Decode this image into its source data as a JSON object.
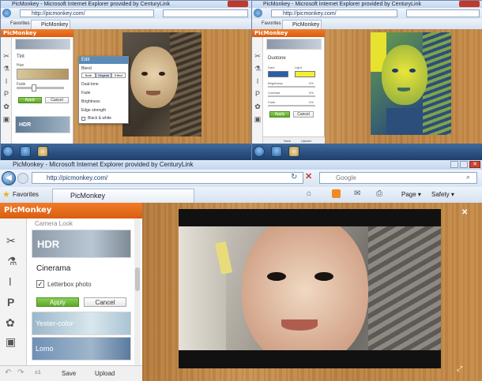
{
  "top_left_window": {
    "title": "PicMonkey - Microsoft Internet Explorer provided by CenturyLink",
    "url": "http://picmonkey.com/",
    "favorites_label": "Favorites",
    "tab_label": "PicMonkey",
    "brand": "PicMonkey",
    "panel": {
      "section_title": "Tint",
      "field1_label": "Hue",
      "field2_label": "Fade",
      "apply_label": "Apply",
      "cancel_label": "Cancel",
      "thumb_label": "HDR"
    },
    "popover": {
      "title": "Edit",
      "mode_label": "Blend",
      "mode_options": [
        "Both",
        "Original",
        "Effect"
      ],
      "rows": [
        "Dual-tone",
        "Fade",
        "Brightness",
        "Edge strength"
      ],
      "checkbox_label": "Black & white"
    }
  },
  "top_right_window": {
    "title": "PicMonkey - Microsoft Internet Explorer provided by CenturyLink",
    "url": "http://picmonkey.com/",
    "favorites_label": "Favorites",
    "tab_label": "PicMonkey",
    "brand": "PicMonkey",
    "panel": {
      "section_title": "Duotone",
      "dark_label": "Dark",
      "light_label": "Light",
      "slider_labels": [
        "Brightness",
        "Contrast",
        "Fade"
      ],
      "slider_values": [
        "0%",
        "0%",
        "0%"
      ],
      "apply_label": "Apply",
      "cancel_label": "Cancel",
      "dark_color": "#2a5ea8",
      "light_color": "#f2ee33"
    },
    "bottom_tools": [
      "Save",
      "Upload"
    ]
  },
  "main_window": {
    "title": "PicMonkey - Microsoft Internet Explorer provided by CenturyLink",
    "url": "http://picmonkey.com/",
    "search_placeholder": "Google",
    "favorites_label": "Favorites",
    "tab_label": "PicMonkey",
    "toolbar": {
      "page_label": "Page ▾",
      "safety_label": "Safety ▾"
    },
    "brand": "PicMonkey",
    "panel": {
      "category_label": "Camera Look",
      "hdr_label": "HDR",
      "selected_effect": "Cinerama",
      "checkbox_label": "Letterbox photo",
      "checkbox_checked": true,
      "apply_label": "Apply",
      "cancel_label": "Cancel",
      "effects": [
        "Yester-color",
        "Lomo"
      ]
    },
    "bottom": {
      "save_label": "Save",
      "upload_label": "Upload",
      "zoom_label": "±1"
    }
  },
  "colors": {
    "brand_orange": "#e8691a",
    "apply_green": "#6db334",
    "ie_blue": "#2c68a8"
  }
}
